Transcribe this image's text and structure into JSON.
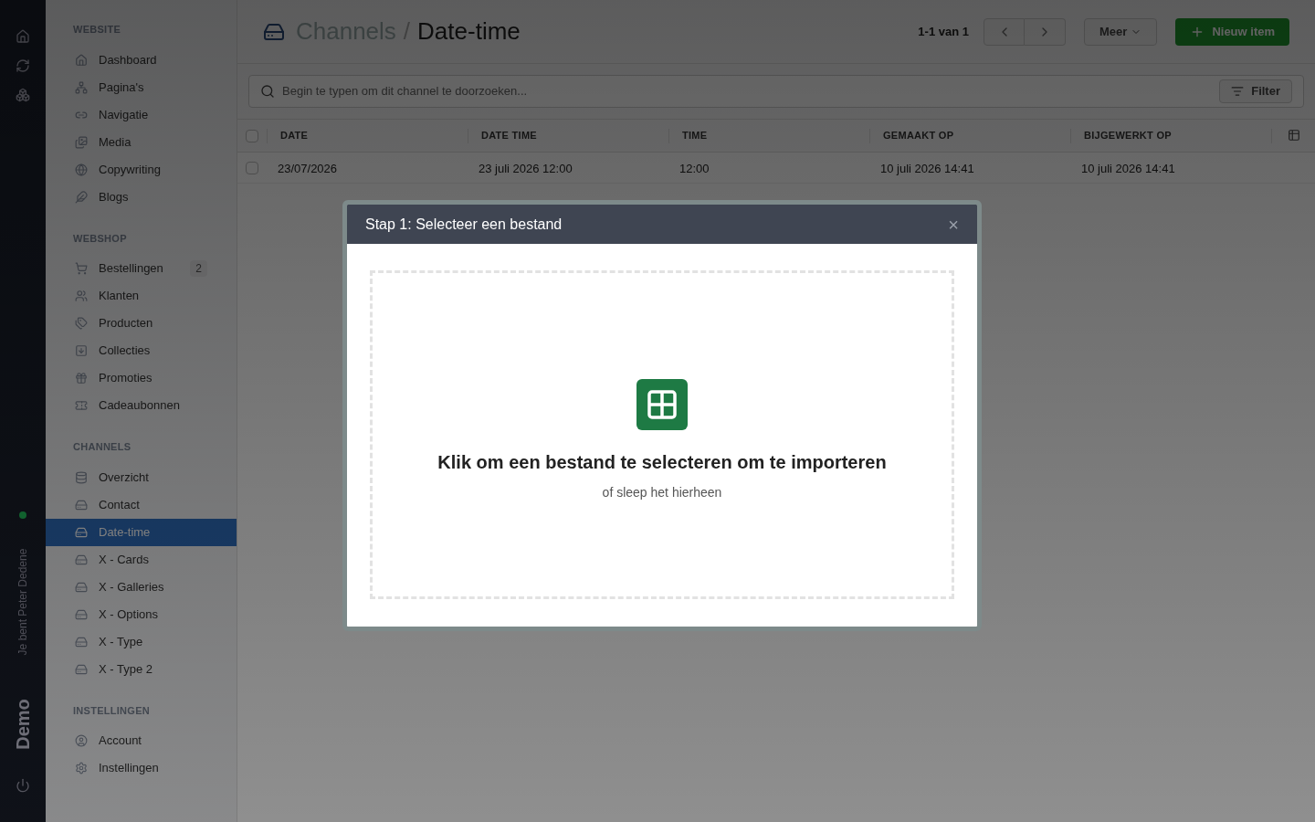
{
  "rail": {
    "user_label": "Je bent Peter Dedene",
    "site_name": "Demo",
    "online": true
  },
  "sidebar": {
    "sections": [
      {
        "title": "WEBSITE",
        "items": [
          {
            "label": "Dashboard",
            "selected": false
          },
          {
            "label": "Pagina's",
            "selected": false
          },
          {
            "label": "Navigatie",
            "selected": false
          },
          {
            "label": "Media",
            "selected": false
          },
          {
            "label": "Copywriting",
            "selected": false
          },
          {
            "label": "Blogs",
            "selected": false
          }
        ]
      },
      {
        "title": "WEBSHOP",
        "items": [
          {
            "label": "Bestellingen",
            "selected": false,
            "badge": "2"
          },
          {
            "label": "Klanten",
            "selected": false
          },
          {
            "label": "Producten",
            "selected": false
          },
          {
            "label": "Collecties",
            "selected": false
          },
          {
            "label": "Promoties",
            "selected": false
          },
          {
            "label": "Cadeaubonnen",
            "selected": false
          }
        ]
      },
      {
        "title": "CHANNELS",
        "items": [
          {
            "label": "Overzicht",
            "selected": false
          },
          {
            "label": "Contact",
            "selected": false
          },
          {
            "label": "Date-time",
            "selected": true
          },
          {
            "label": "X - Cards",
            "selected": false
          },
          {
            "label": "X - Galleries",
            "selected": false
          },
          {
            "label": "X - Options",
            "selected": false
          },
          {
            "label": "X - Type",
            "selected": false
          },
          {
            "label": "X - Type 2",
            "selected": false
          }
        ]
      },
      {
        "title": "INSTELLINGEN",
        "items": [
          {
            "label": "Account",
            "selected": false
          },
          {
            "label": "Instellingen",
            "selected": false
          }
        ]
      }
    ]
  },
  "header": {
    "breadcrumb_parent": "Channels",
    "breadcrumb_separator": "/",
    "title": "Date-time",
    "pagination": "1-1 van 1",
    "more_button": "Meer",
    "new_button": "Nieuw item"
  },
  "search": {
    "placeholder": "Begin te typen om dit channel te doorzoeken...",
    "filter_button": "Filter"
  },
  "table": {
    "all_checked": false,
    "columns": [
      "DATE",
      "DATE TIME",
      "TIME",
      "GEMAAKT OP",
      "BIJGEWERKT OP"
    ],
    "rows": [
      {
        "checked": false,
        "cells": [
          "23/07/2026",
          "23 juli 2026 12:00",
          "12:00",
          "10 juli 2026 14:41",
          "10 juli 2026 14:41"
        ]
      }
    ]
  },
  "modal": {
    "title": "Stap 1: Selecteer een bestand",
    "close": "×",
    "drop_title": "Klik om een bestand te selecteren om te importeren",
    "drop_hint": "of sleep het hierheen"
  }
}
